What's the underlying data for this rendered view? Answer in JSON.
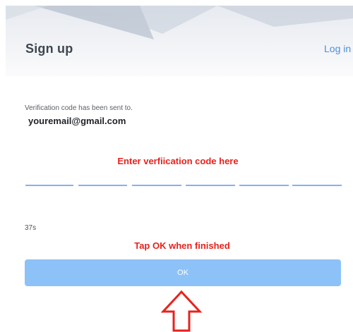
{
  "header": {
    "title": "Sign up",
    "login_label": "Log in"
  },
  "verification": {
    "sent_label": "Verification code has been sent to.",
    "email": "youremail@gmail.com",
    "code_digits": [
      "",
      "",
      "",
      "",
      "",
      ""
    ],
    "countdown": "37s"
  },
  "annotations": {
    "enter_code": "Enter verfiication code here",
    "tap_ok": "Tap OK when finished",
    "arrow_icon": "up-arrow-outline-icon"
  },
  "ok_button": {
    "label": "OK"
  },
  "colors": {
    "accent": "#4a8fe2",
    "button": "#8dc2f8",
    "underline": "#7fb4f4",
    "annotation": "#e8221c"
  }
}
